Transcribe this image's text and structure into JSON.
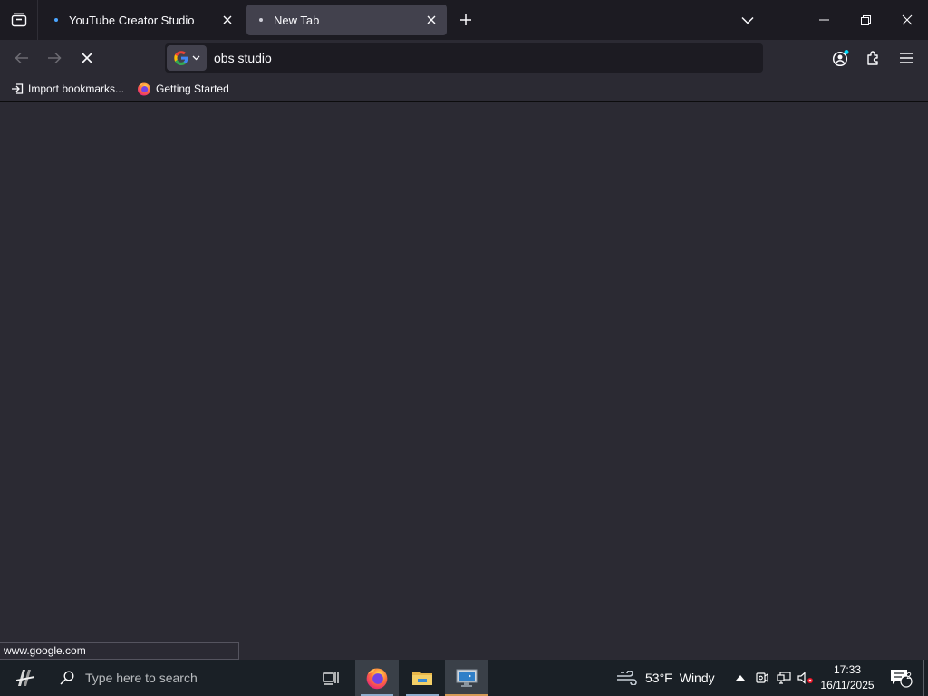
{
  "tabs": [
    {
      "label": "YouTube Creator Studio",
      "active": false
    },
    {
      "label": "New Tab",
      "active": true
    }
  ],
  "urlbar": {
    "value": "obs studio",
    "engine_icon": "google-g-icon"
  },
  "bookmarks": [
    {
      "label": "Import bookmarks...",
      "icon": "import-icon"
    },
    {
      "label": "Getting Started",
      "icon": "firefox-icon"
    }
  ],
  "status_text": "www.google.com",
  "taskbar": {
    "search_placeholder": "Type here to search",
    "weather_temp": "53°F",
    "weather_desc": "Windy",
    "time": "17:33",
    "date": "16/11/2025",
    "notification_count": "2"
  },
  "colors": {
    "tabstrip_bg": "#1c1b22",
    "toolbar_bg": "#2b2a33",
    "active_tab_bg": "#42414d",
    "taskbar_bg": "#1a2026"
  }
}
